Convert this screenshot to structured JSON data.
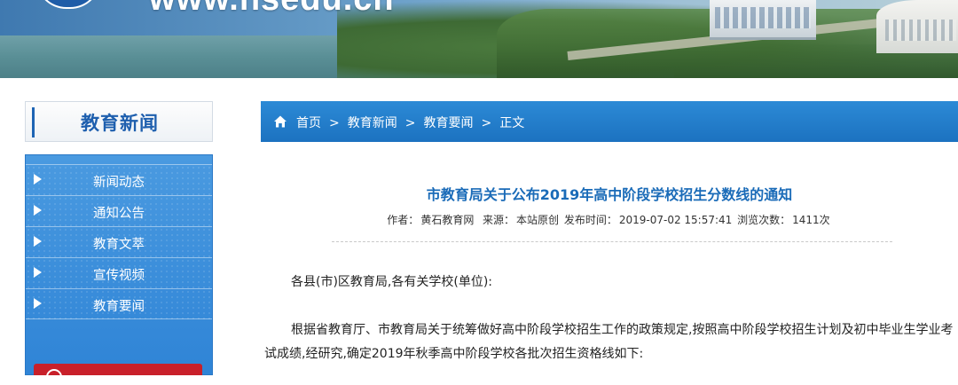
{
  "banner": {
    "logo_text": "www.hsedu.cn"
  },
  "sidebar": {
    "title": "教育新闻",
    "items": [
      {
        "label": "新闻动态"
      },
      {
        "label": "通知公告"
      },
      {
        "label": "教育文萃"
      },
      {
        "label": "宣传视频"
      },
      {
        "label": "教育要闻"
      }
    ]
  },
  "breadcrumb": {
    "home_icon": "home-icon",
    "items": [
      "首页",
      "教育新闻",
      "教育要闻"
    ],
    "separator": ">",
    "current": "正文"
  },
  "article": {
    "title": "市教育局关于公布2019年高中阶段学校招生分数线的通知",
    "meta": {
      "author_label": "作者：",
      "author": "黄石教育网",
      "source_label": "来源：",
      "source": "本站原创",
      "time_label": "发布时间：",
      "time": "2019-07-02 15:57:41",
      "views_label": "浏览次数：",
      "views": "1411次"
    },
    "paragraphs": [
      "各县(市)区教育局,各有关学校(单位):",
      "根据省教育厅、市教育局关于统筹做好高中阶段学校招生工作的政策规定,按照高中阶段学校招生计划及初中毕业生学业考试成绩,经研究,确定2019年秋季高中阶段学校各批次招生资格线如下:"
    ]
  },
  "colors": {
    "accent_blue": "#1e72c0",
    "title_blue": "#1a6bb8",
    "promo_red": "#c8202a"
  }
}
